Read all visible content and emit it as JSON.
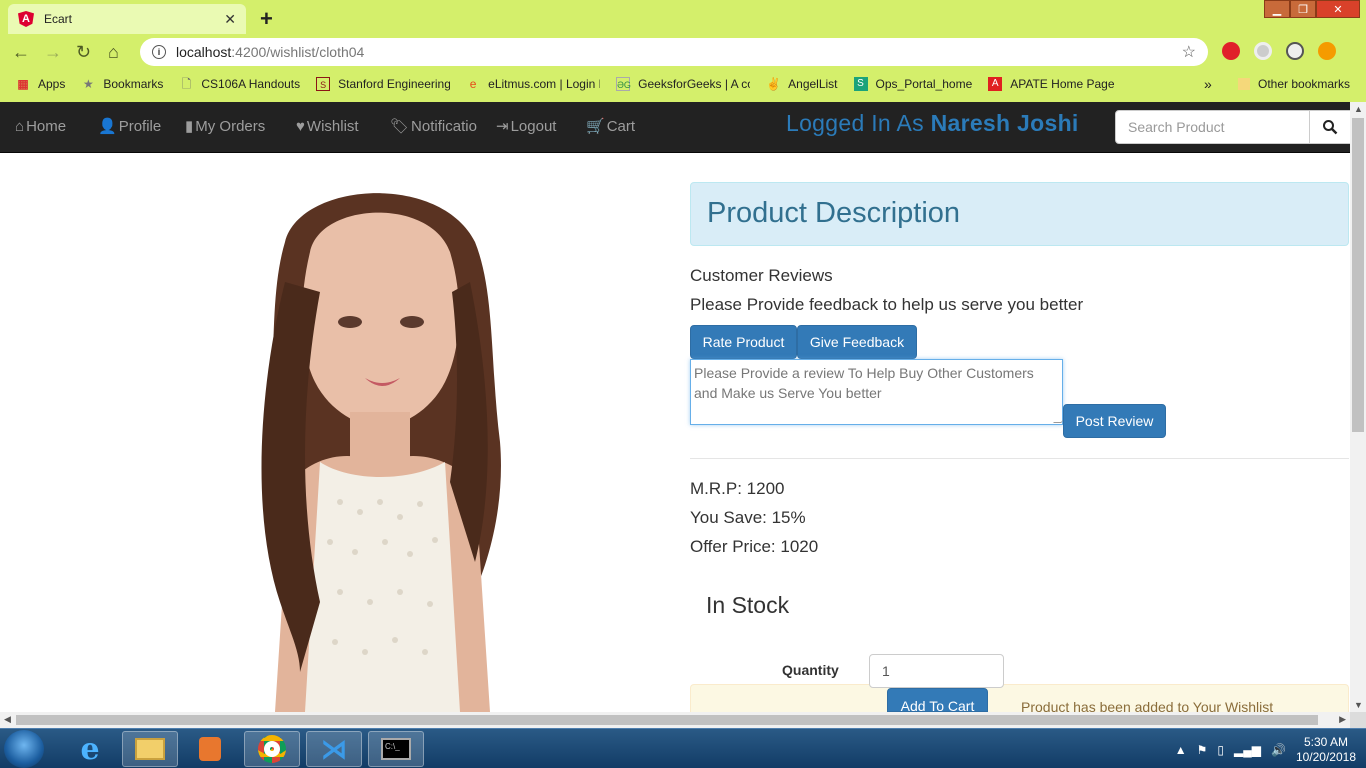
{
  "browser": {
    "tab_title": "Ecart",
    "url_host": "localhost",
    "url_path": ":4200/wishlist/cloth04",
    "bookmarks": [
      {
        "label": "Apps",
        "icon": "apps-grid-icon"
      },
      {
        "label": "Bookmarks",
        "icon": "star-icon"
      },
      {
        "label": "CS106A Handouts",
        "icon": "page-icon"
      },
      {
        "label": "Stanford Engineering",
        "icon": "stanford-icon"
      },
      {
        "label": "eLitmus.com | Login F",
        "icon": "elitmus-icon"
      },
      {
        "label": "GeeksforGeeks | A co",
        "icon": "gfg-icon"
      },
      {
        "label": "AngelList",
        "icon": "angellist-icon"
      },
      {
        "label": "Ops_Portal_home",
        "icon": "ops-icon"
      },
      {
        "label": "APATE Home Page",
        "icon": "apate-icon"
      }
    ],
    "more_bookmarks": "»",
    "other_bookmarks": "Other bookmarks"
  },
  "nav": {
    "home": "Home",
    "profile": "Profile",
    "orders": "My Orders",
    "wishlist": "Wishlist",
    "notifications": "Notificatio",
    "logout": "Logout",
    "cart": "Cart",
    "logged_prefix": "Logged In As ",
    "user_name": "Naresh Joshi",
    "search_placeholder": "Search Product"
  },
  "product": {
    "panel_title": "Product Description",
    "reviews_heading": "Customer Reviews",
    "feedback_prompt": "Please Provide feedback to help us serve you better",
    "rate_button": "Rate Product",
    "feedback_button": "Give Feedback",
    "review_placeholder": "Please Provide a review To Help Buy Other Customers and Make us Serve You better",
    "post_button": "Post Review",
    "mrp": "M.R.P: 1200",
    "save": "You Save: 15%",
    "offer": "Offer Price: 1020",
    "stock": "In Stock",
    "qty_label": "Quantity",
    "qty_value": "1",
    "add_to_cart": "Add To Cart",
    "wishlist_msg": "Product has been added to Your Wishlist"
  },
  "taskbar": {
    "time": "5:30 AM",
    "date": "10/20/2018"
  },
  "colors": {
    "chrome_bg": "#d4ef6b",
    "navbar_bg": "#222222",
    "primary": "#337ab7",
    "info_bg": "#d9edf7",
    "warning_bg": "#fcf8e3"
  }
}
